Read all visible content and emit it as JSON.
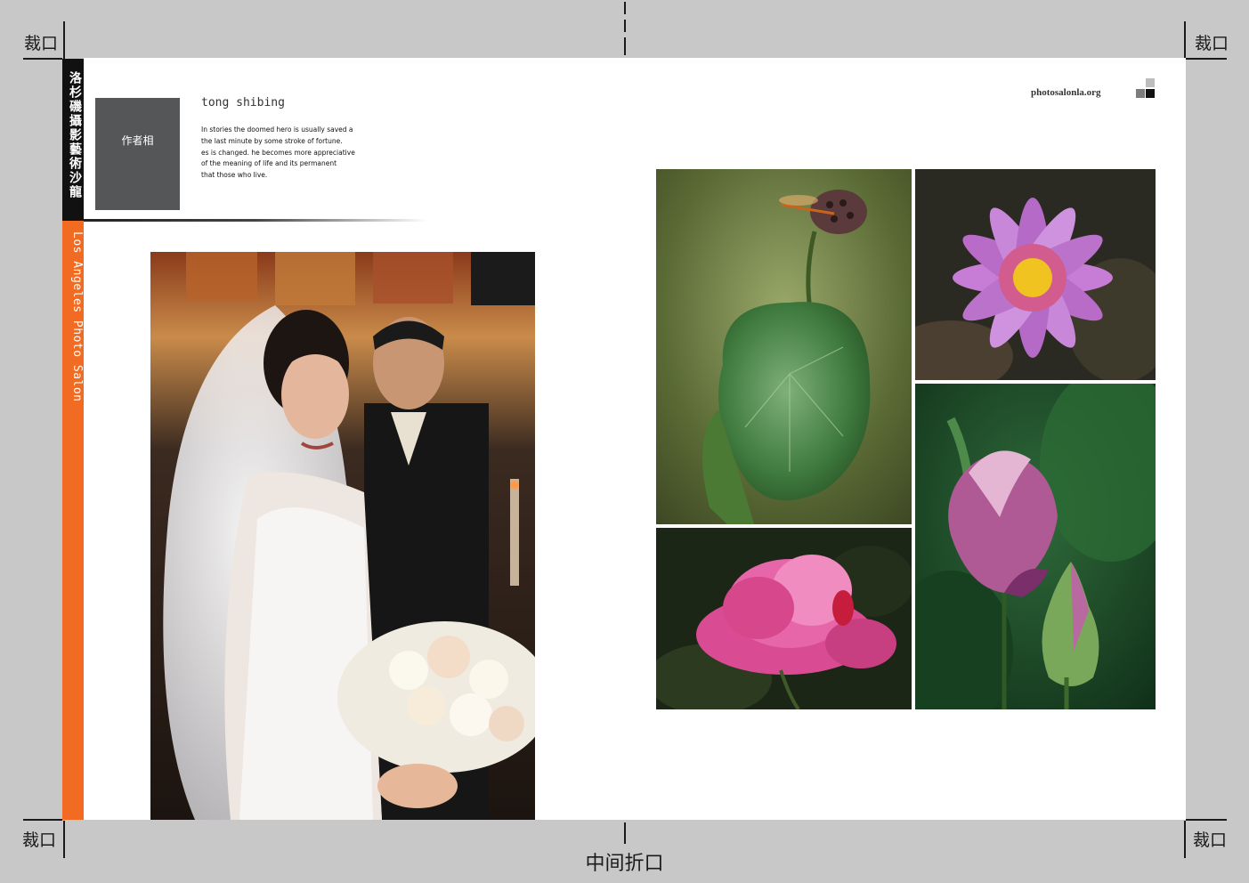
{
  "crop_label": "裁口",
  "fold_label": "中间折口",
  "sidebar": {
    "chinese_title": "洛杉磯攝影藝術沙龍",
    "english_title": "Los Angeles Photo Salon"
  },
  "author": {
    "photo_placeholder": "作者相",
    "name": "tong shibing",
    "bio_lines": [
      "In stories the doomed hero is usually saved a",
      "the last minute by some stroke of fortune.",
      "es is changed. he becomes more appreciative",
      "of the meaning of life and its permanent",
      "that those who live."
    ]
  },
  "site": "photosalonla.org",
  "colors": {
    "accent_orange": "#f26b22",
    "sidebar_black": "#111111",
    "placeholder_gray": "#555657",
    "background_gray": "#c8c8c9"
  },
  "photos": [
    {
      "name": "bride-photo",
      "subject": "bride with veil and bouquet"
    },
    {
      "name": "lotus-leaf-dragonfly-photo",
      "subject": "lotus seed pod with dragonfly over leaf"
    },
    {
      "name": "purple-cactus-flower-photo",
      "subject": "purple cactus flower"
    },
    {
      "name": "pink-lotus-flower-photo",
      "subject": "pink lotus flower"
    },
    {
      "name": "lotus-buds-photo",
      "subject": "lotus buds with dew"
    }
  ]
}
